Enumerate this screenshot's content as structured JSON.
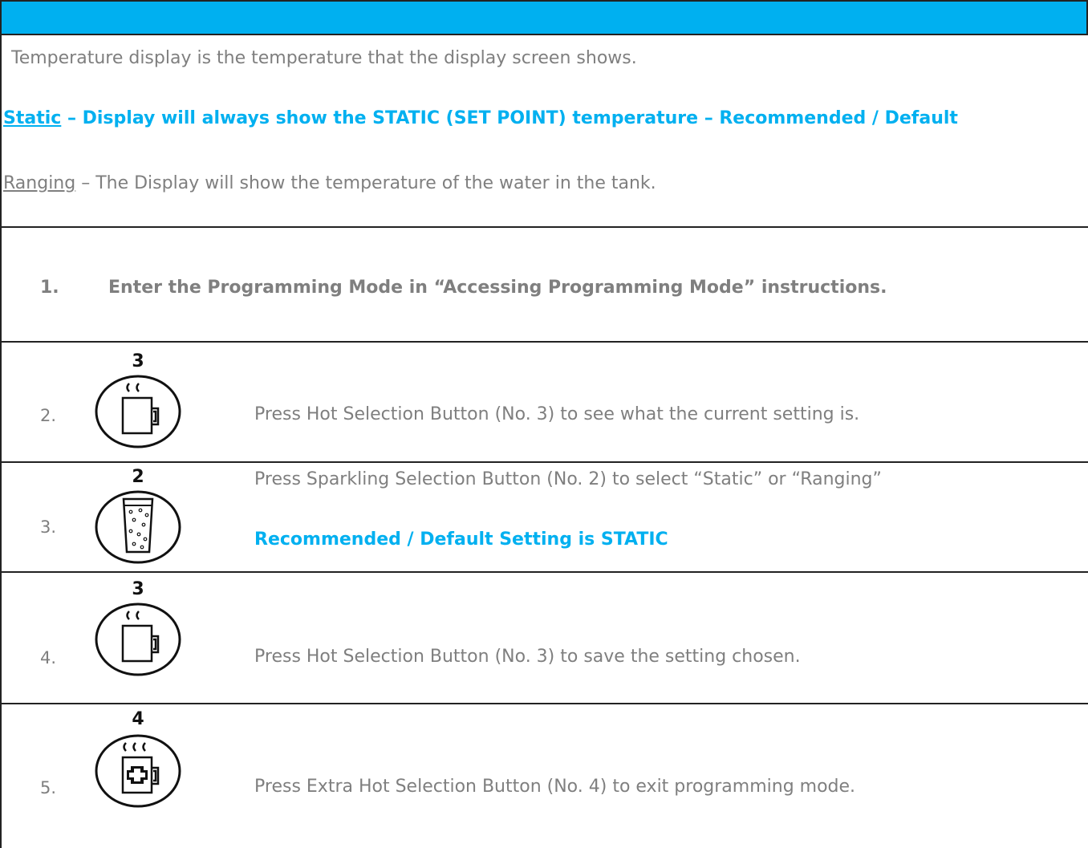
{
  "intro": {
    "description": "Temperature display is the temperature that the display screen shows.",
    "static_label": "Static",
    "static_text": " – Display will always show the STATIC (SET POINT) temperature – Recommended / Default",
    "ranging_label": "Ranging",
    "ranging_text": " – The Display will show the temperature of the water in the tank."
  },
  "steps": [
    {
      "number": "1.",
      "text": "Enter the Programming Mode in “Accessing Programming Mode” instructions."
    },
    {
      "number": "2.",
      "button_number": "3",
      "icon": "hot-cup-icon",
      "text": "Press Hot Selection Button (No. 3) to see what the current setting is."
    },
    {
      "number": "3.",
      "button_number": "2",
      "icon": "sparkling-glass-icon",
      "text": "Press Sparkling Selection Button (No. 2) to select “Static” or “Ranging”",
      "note": "Recommended / Default Setting is STATIC"
    },
    {
      "number": "4.",
      "button_number": "3",
      "icon": "hot-cup-icon",
      "text": "Press Hot Selection Button (No. 3) to save the setting chosen."
    },
    {
      "number": "5.",
      "button_number": "4",
      "icon": "extra-hot-cup-icon",
      "text": "Press Extra Hot Selection Button (No. 4) to exit programming mode."
    }
  ],
  "colors": {
    "accent": "#00b0f0",
    "text": "#7f7f7f",
    "border": "#222222"
  }
}
